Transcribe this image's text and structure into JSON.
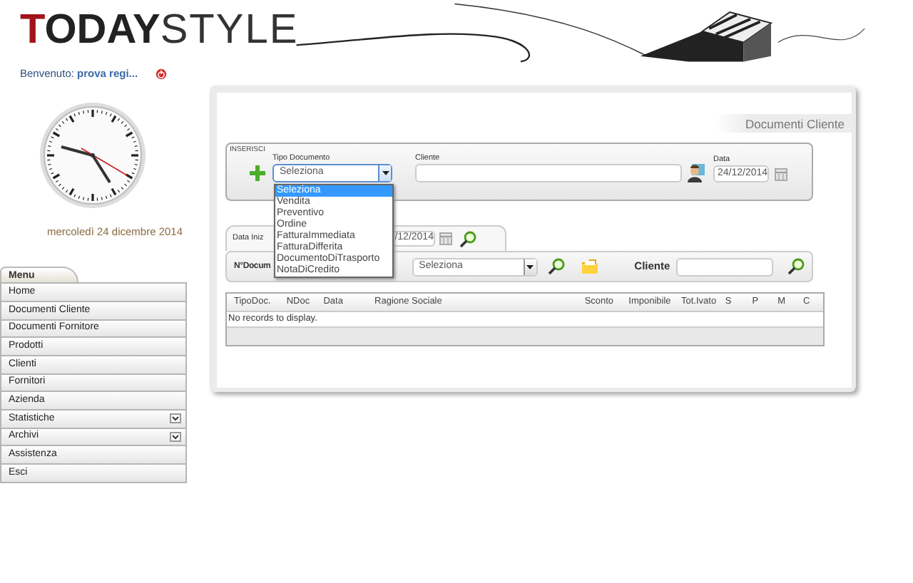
{
  "header": {
    "logo": {
      "part_1": "TODAY",
      "part_2": "STYLE"
    }
  },
  "welcome": {
    "label": "Benvenuto:",
    "user": "prova regi..."
  },
  "clock_date": "mercoledì 24 dicembre 2014",
  "menu": {
    "title": "Menu",
    "items": [
      {
        "label": "Home",
        "expandable": false
      },
      {
        "label": "Documenti Cliente",
        "expandable": false
      },
      {
        "label": "Documenti Fornitore",
        "expandable": false
      },
      {
        "label": "Prodotti",
        "expandable": false
      },
      {
        "label": "Clienti",
        "expandable": false
      },
      {
        "label": "Fornitori",
        "expandable": false
      },
      {
        "label": "Azienda",
        "expandable": false
      },
      {
        "label": "Statistiche",
        "expandable": true
      },
      {
        "label": "Archivi",
        "expandable": true
      },
      {
        "label": "Assistenza",
        "expandable": false
      },
      {
        "label": "Esci",
        "expandable": false
      }
    ]
  },
  "panel": {
    "title": "Documenti Cliente",
    "insert": {
      "legend": "INSERISCI",
      "doc_type": {
        "label": "Tipo Documento",
        "value": "Seleziona",
        "expanded": true,
        "options": [
          {
            "label": "Seleziona",
            "selected": true
          },
          {
            "label": "Vendita",
            "selected": false
          },
          {
            "label": "Preventivo",
            "selected": false
          },
          {
            "label": "Ordine",
            "selected": false
          },
          {
            "label": "FatturaImmediata",
            "selected": false
          },
          {
            "label": "FatturaDifferita",
            "selected": false
          },
          {
            "label": "DocumentoDiTrasporto",
            "selected": false
          },
          {
            "label": "NotaDiCredito",
            "selected": false
          }
        ]
      },
      "client": {
        "label": "Cliente"
      },
      "date": {
        "label": "Data",
        "value": "24/12/2014"
      }
    },
    "search": {
      "date_from_label": "Data Iniz",
      "date_to_value": "/12/2014",
      "doc_number_label": "N°Docum",
      "doc_type_value": "Seleziona",
      "client_label": "Cliente"
    },
    "table": {
      "columns": [
        "TipoDoc.",
        "NDoc",
        "Data",
        "Ragione Sociale",
        "Sconto",
        "Imponibile",
        "Tot.Ivato",
        "S",
        "P",
        "M",
        "C"
      ],
      "empty_message": "No records to display."
    }
  }
}
